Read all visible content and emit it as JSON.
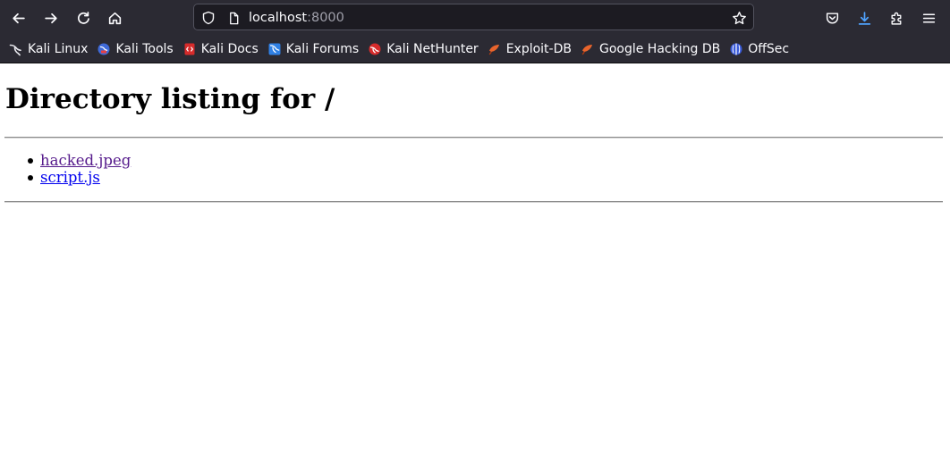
{
  "browser": {
    "url": {
      "host": "localhost",
      "port": ":8000"
    },
    "bookmarks": [
      {
        "label": "Kali Linux",
        "icon": "kali-dragon-icon"
      },
      {
        "label": "Kali Tools",
        "icon": "kali-tools-icon"
      },
      {
        "label": "Kali Docs",
        "icon": "kali-docs-icon"
      },
      {
        "label": "Kali Forums",
        "icon": "kali-forums-icon"
      },
      {
        "label": "Kali NetHunter",
        "icon": "kali-nethunter-icon"
      },
      {
        "label": "Exploit-DB",
        "icon": "exploit-db-icon"
      },
      {
        "label": "Google Hacking DB",
        "icon": "ghdb-icon"
      },
      {
        "label": "OffSec",
        "icon": "offsec-icon"
      }
    ],
    "colors": {
      "chrome": "#2b2a33",
      "urlbar": "#1c1b22",
      "download_accent": "#4fa3ff"
    }
  },
  "page": {
    "title": "Directory listing for /",
    "files": [
      {
        "name": "hacked.jpeg",
        "visited": true
      },
      {
        "name": "script.js",
        "visited": false
      }
    ]
  }
}
